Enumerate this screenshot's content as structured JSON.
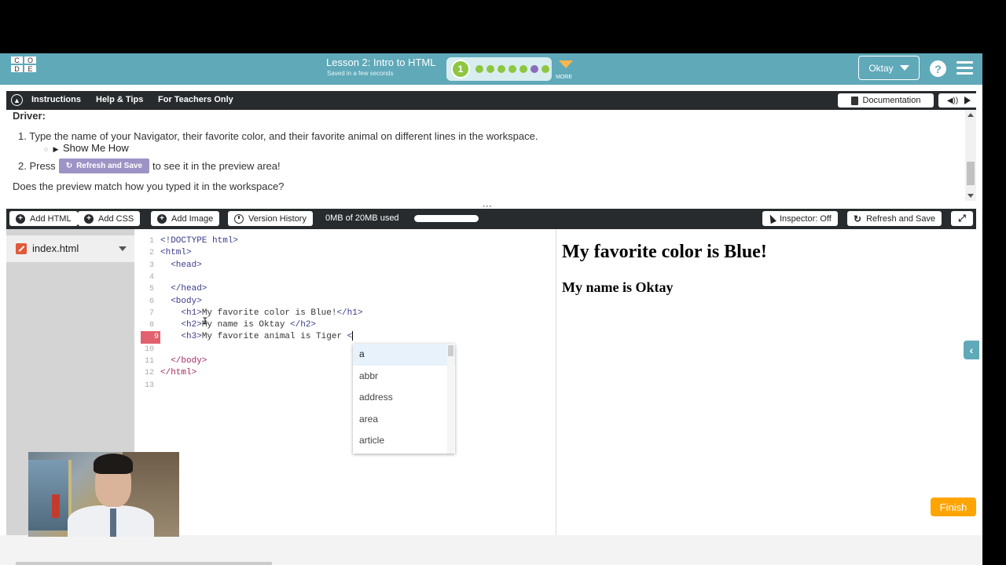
{
  "header": {
    "logo_letters": [
      "C",
      "O",
      "D",
      "E"
    ],
    "lesson_title": "Lesson 2: Intro to HTML",
    "save_status": "Saved in a few seconds",
    "progress_current": "1",
    "more_label": "MORE",
    "user_name": "Oktay",
    "help_label": "?"
  },
  "instructions_bar": {
    "tabs": [
      "Instructions",
      "Help & Tips",
      "For Teachers Only"
    ],
    "documentation_label": "Documentation"
  },
  "instructions": {
    "heading": "Driver:",
    "step1": "1. Type the name of your Navigator, their favorite color, and their favorite animal on different lines in the workspace.",
    "show_me_how": "Show Me How",
    "step2_prefix": "2. Press",
    "step2_button": "Refresh and Save",
    "step2_suffix": "to see it in the preview area!",
    "question": "Does the preview match how you typed it in the workspace?"
  },
  "toolbar": {
    "add_html": "Add HTML",
    "add_css": "Add CSS",
    "add_image": "Add Image",
    "version_history": "Version History",
    "usage": "0MB of 20MB used",
    "inspector": "Inspector: Off",
    "refresh_save": "Refresh and Save"
  },
  "sidebar": {
    "file_name": "index.html"
  },
  "editor": {
    "line_numbers": [
      "1",
      "2",
      "3",
      "4",
      "5",
      "6",
      "7",
      "8",
      "9",
      "10",
      "11",
      "12",
      "13"
    ],
    "active_line": "9",
    "lines": [
      {
        "tag": "<!DOCTYPE html>",
        "text": "",
        "close": ""
      },
      {
        "tag": "<html>",
        "text": "",
        "close": ""
      },
      {
        "tag": "  <head>",
        "text": "",
        "close": ""
      },
      {
        "tag": "",
        "text": "",
        "close": ""
      },
      {
        "tag": "  </head>",
        "text": "",
        "close": ""
      },
      {
        "tag": "  <body>",
        "text": "",
        "close": ""
      },
      {
        "tag": "    <h1>",
        "text": "My favorite color is Blue!",
        "close": "</h1>"
      },
      {
        "tag": "    <h2>",
        "text": "My name is Oktay ",
        "close": "</h2>"
      },
      {
        "tag": "    <h3>",
        "text": "My favorite animal is Tiger ",
        "close": "<"
      },
      {
        "tag": "",
        "text": "",
        "close": ""
      },
      {
        "tag": "  </body>",
        "text": "",
        "close": ""
      },
      {
        "tag": "</html>",
        "text": "",
        "close": ""
      },
      {
        "tag": "",
        "text": "",
        "close": ""
      }
    ],
    "autocomplete": [
      "a",
      "abbr",
      "address",
      "area",
      "article"
    ]
  },
  "preview": {
    "h1": "My favorite color is Blue!",
    "h2": "My name is Oktay"
  },
  "footer": {
    "finish_label": "Finish"
  },
  "colors": {
    "header_bg": "#5fa9b9",
    "dark_bar": "#272b2e",
    "progress_green": "#8ec641",
    "finish_orange": "#ffa400",
    "active_line": "#e2616f"
  },
  "icons": [
    "logo",
    "chevron-up-icon",
    "book-icon",
    "speaker-icon",
    "play-icon",
    "plus-icon",
    "clock-icon",
    "cursor-icon",
    "refresh-icon",
    "expand-icon",
    "file-icon",
    "chevron-left-icon",
    "hamburger-icon",
    "help-icon"
  ]
}
